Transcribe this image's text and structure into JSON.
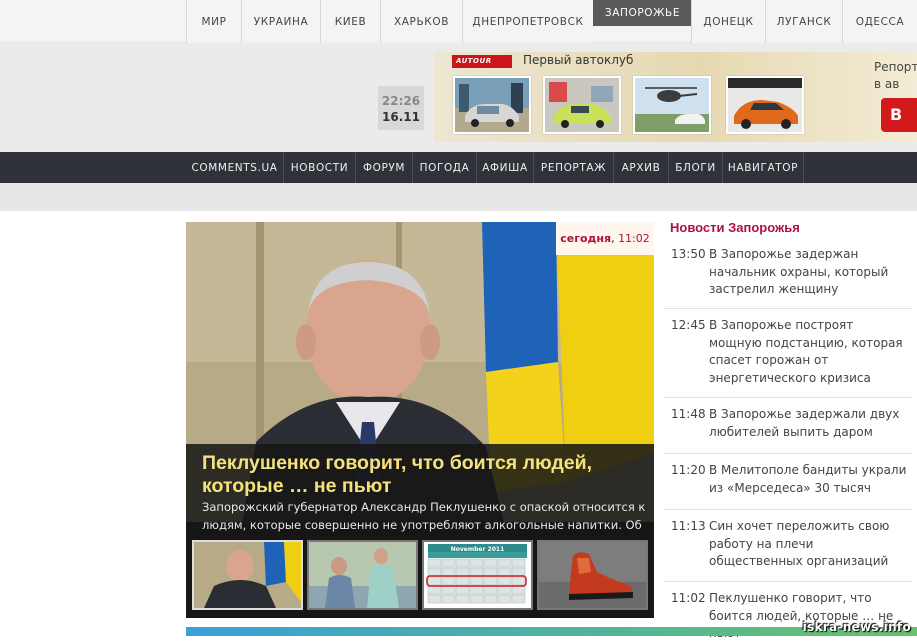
{
  "city_nav": {
    "items": [
      {
        "label": "МИР",
        "active": false
      },
      {
        "label": "УКРАИНА",
        "active": false
      },
      {
        "label": "КИЕВ",
        "active": false
      },
      {
        "label": "ХАРЬКОВ",
        "active": false
      },
      {
        "label": "ДНЕПРОПЕТРОВСК",
        "active": false
      },
      {
        "label": "ЗАПОРОЖЬЕ",
        "active": true
      },
      {
        "label": "ДОНЕЦК",
        "active": false
      },
      {
        "label": "ЛУГАНСК",
        "active": false
      },
      {
        "label": "ОДЕССА",
        "active": false
      }
    ]
  },
  "clock": {
    "time": "22:26",
    "date": "16.11"
  },
  "banner": {
    "logo": "AUTOUR",
    "title": "Первый автоклуб",
    "side_text": "Репорта в ав",
    "button_label": "В"
  },
  "main_nav": {
    "items": [
      "COMMENTS.UA",
      "НОВОСТИ",
      "ФОРУМ",
      "ПОГОДА",
      "АФИША",
      "РЕПОРТАЖ",
      "АРХИВ",
      "БЛОГИ",
      "НАВИГАТОР"
    ]
  },
  "featured": {
    "timestamp_day": "сегодня",
    "timestamp_time": "11:02",
    "headline": "Пеклушенко говорит, что боится людей, которые … не пьют",
    "lede": "Запорожский губернатор Александр Пеклушенко с опаской относится к людям, которые совершенно не употребляют алкогольные напитки. Об этом,",
    "calendar_month": "November 2011"
  },
  "news": {
    "heading": "Новости Запорожья",
    "items": [
      {
        "time": "13:50",
        "title": "В Запорожье задержан начальник охраны, который застрелил женщину"
      },
      {
        "time": "12:45",
        "title": "В Запорожье построят мощную подстанцию, которая спасет горожан от энергетического кризиса"
      },
      {
        "time": "11:48",
        "title": "В Запорожье задержали двух любителей выпить даром"
      },
      {
        "time": "11:20",
        "title": "В Мелитополе бандиты украли из «Мерседеса» 30 тысяч"
      },
      {
        "time": "11:13",
        "title": "Син хочет переложить свою работу на плечи общественных организаций"
      },
      {
        "time": "11:02",
        "title": "Пеклушенко говорит, что боится людей, которые … не пьют"
      }
    ]
  },
  "watermark": "iskra-news.info",
  "colors": {
    "accent": "#b01040",
    "nav_bg": "#2f3238",
    "headline_yellow": "#f5e27a"
  }
}
